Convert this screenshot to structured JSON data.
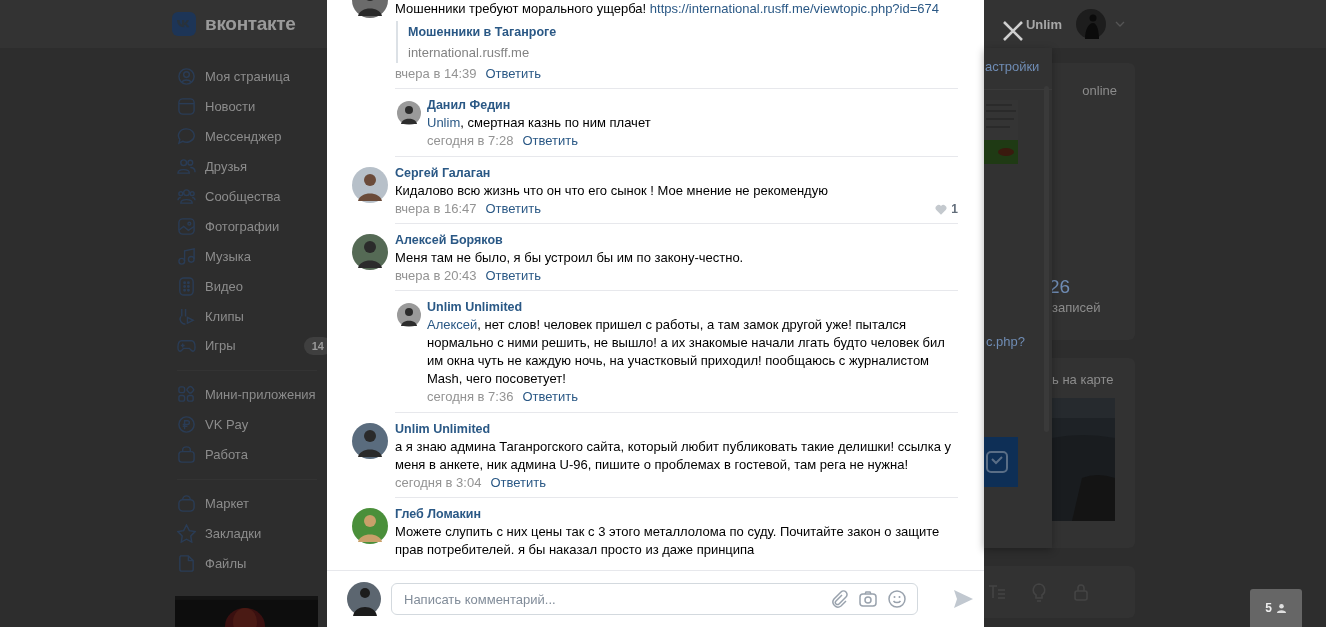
{
  "header": {
    "logo": "вконтакте",
    "user": "Unlim"
  },
  "sidebar": {
    "groups": [
      [
        {
          "label": "Моя страница"
        },
        {
          "label": "Новости"
        },
        {
          "label": "Мессенджер"
        },
        {
          "label": "Друзья"
        },
        {
          "label": "Сообщества"
        },
        {
          "label": "Фотографии"
        },
        {
          "label": "Музыка"
        },
        {
          "label": "Видео"
        },
        {
          "label": "Клипы"
        },
        {
          "label": "Игры",
          "badge": "14"
        }
      ],
      [
        {
          "label": "Мини-приложения"
        },
        {
          "label": "VK Pay"
        },
        {
          "label": "Работа"
        }
      ],
      [
        {
          "label": "Маркет"
        },
        {
          "label": "Закладки"
        },
        {
          "label": "Файлы"
        }
      ]
    ]
  },
  "background": {
    "settings_tab": "астройки",
    "link_fragment": "c.php?",
    "status": "online",
    "count": "26",
    "count_label": "записей",
    "map_link": "ь на карте"
  },
  "online_counter": "5",
  "comments": [
    {
      "text": "Мошенники требуют морального ущерба! ",
      "link": "https://international.rusff.me/viewtopic.php?id=674",
      "preview": {
        "title": "Мошенники в Таганроге",
        "domain": "international.rusff.me"
      },
      "time": "вчера в 14:39",
      "reply": "Ответить",
      "replies": [
        {
          "author": "Данил Федин",
          "mention": "Unlim",
          "text": ", смертная казнь по ним плачет",
          "time": "сегодня в 7:28",
          "reply": "Ответить"
        }
      ]
    },
    {
      "author": "Сергей Галаган",
      "text": "Кидалово всю жизнь что он что его сынок ! Мое мнение не рекомендую",
      "time": "вчера в 16:47",
      "reply": "Ответить",
      "likes": "1"
    },
    {
      "author": "Алексей Боряков",
      "text": "Меня там не было, я бы устроил бы им по закону-честно.",
      "time": "вчера в 20:43",
      "reply": "Ответить",
      "replies": [
        {
          "author": "Unlim Unlimited",
          "mention": "Алексей",
          "text": ", нет слов! человек пришел с работы, а там замок другой уже! пытался нормально с ними решить, не вышло! а их знакомые начали лгать будто человек бил им окна чуть не каждую ночь, на участковый приходил! пообщаюсь с журналистом Mash, чего посоветует!",
          "time": "сегодня в 7:36",
          "reply": "Ответить"
        }
      ]
    },
    {
      "author": "Unlim Unlimited",
      "text": "а я знаю админа Таганрогского сайта, который любит публиковать такие делишки! ссылка у меня в анкете, ник админа U-96, пишите о проблемах в гостевой, там рега не нужна!",
      "time": "сегодня в 3:04",
      "reply": "Ответить"
    },
    {
      "author": "Глеб Ломакин",
      "text": "Можете слупить с них цены так с 3 этого металлолома по суду. Почитайте закон о защите прав потребителей. я бы наказал просто из даже принципа"
    }
  ],
  "composer": {
    "placeholder": "Написать комментарий..."
  }
}
